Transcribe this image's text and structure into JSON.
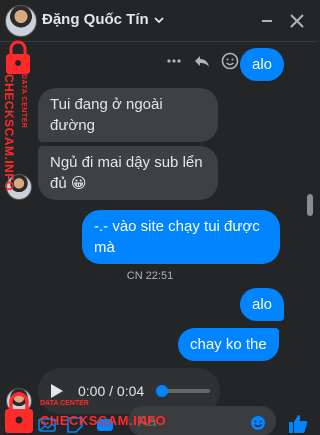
{
  "header": {
    "contact_name": "Đặng Quốc Tín"
  },
  "messages": [
    {
      "side": "out",
      "text": "alo"
    },
    {
      "side": "in",
      "text": "Tui đang ở ngoài đường"
    },
    {
      "side": "in",
      "text": "Ngủ đi mai dậy sub lển đủ 😀"
    },
    {
      "side": "out",
      "text": "-.- vào site chạy tui được mà"
    },
    {
      "side": "out",
      "text": "alo"
    },
    {
      "side": "out",
      "text": "chay ko the"
    }
  ],
  "timestamp": "CN 22:51",
  "audio": {
    "time": "0:00 / 0:04",
    "progress": 0
  },
  "composer": {
    "placeholder": "Aa"
  },
  "watermark": {
    "top_small": "DATA CENTER",
    "top_big": "CHECKSCAM.INFO",
    "bottom_small": "DATA CENTER",
    "bottom_big": "CHECKSCAM.INFO"
  },
  "colors": {
    "background": "#242526",
    "incoming_bubble": "#3e4042",
    "outgoing_bubble": "#0084ff",
    "watermark": "#ff2a2a"
  }
}
